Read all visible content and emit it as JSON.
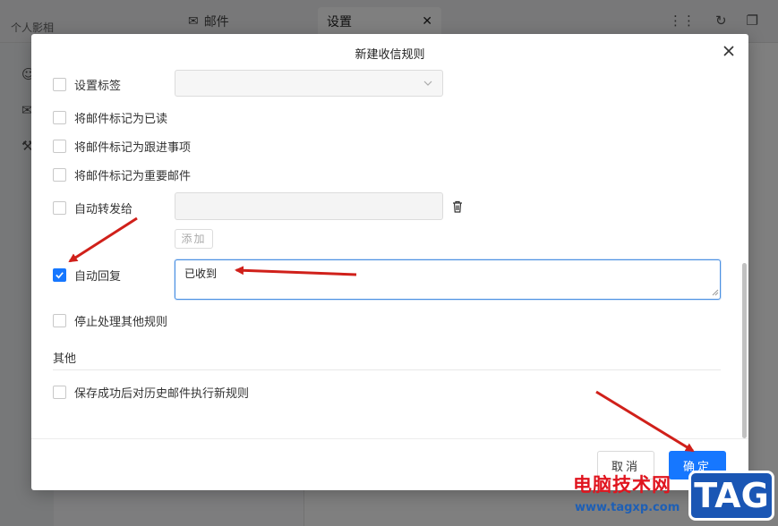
{
  "app": {
    "title": "个人影相",
    "tabs": [
      {
        "label": "邮件"
      },
      {
        "label": "设置"
      }
    ]
  },
  "dialog": {
    "title": "新建收信规则",
    "options": [
      {
        "label": "设置标签",
        "checked": false
      },
      {
        "label": "将邮件标记为已读",
        "checked": false
      },
      {
        "label": "将邮件标记为跟进事项",
        "checked": false
      },
      {
        "label": "将邮件标记为重要邮件",
        "checked": false
      },
      {
        "label": "自动转发给",
        "checked": false
      },
      {
        "label": "自动回复",
        "checked": true
      },
      {
        "label": "停止处理其他规则",
        "checked": false
      }
    ],
    "add_button": "添加",
    "auto_reply_text": "已收到",
    "section_other": "其他",
    "history_option": {
      "label": "保存成功后对历史邮件执行新规则",
      "checked": false
    },
    "cancel_button": "取消",
    "ok_button": "确定"
  },
  "watermark": {
    "site_name": "电脑技术网",
    "url": "www.tagxp.com",
    "tag": "TAG"
  },
  "colors": {
    "accent": "#1677ff",
    "annotation_arrow": "#d0201a"
  }
}
